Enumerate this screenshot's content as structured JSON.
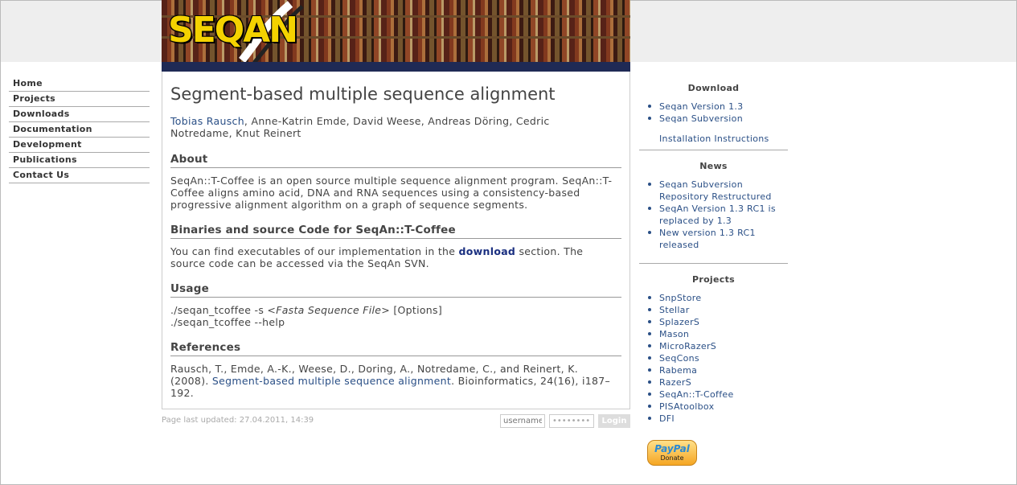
{
  "site": {
    "logo_text": "SEQAN"
  },
  "nav": [
    {
      "label": "Home"
    },
    {
      "label": "Projects"
    },
    {
      "label": "Downloads"
    },
    {
      "label": "Documentation"
    },
    {
      "label": "Development"
    },
    {
      "label": "Publications"
    },
    {
      "label": "Contact Us"
    }
  ],
  "main": {
    "title": "Segment-based multiple sequence alignment",
    "authors_link": "Tobias Rausch",
    "authors_rest": ", Anne-Katrin Emde, David Weese, Andreas Döring, Cedric Notredame, Knut Reinert",
    "about_heading": "About",
    "about_text": "SeqAn::T-Coffee is an open source multiple sequence alignment program. SeqAn::T-Coffee aligns amino acid, DNA and RNA sequences using a consistency-based progressive alignment algorithm on a graph of sequence segments.",
    "binaries_heading": "Binaries and source Code for SeqAn::T-Coffee",
    "binaries_pre": "You can find executables of our implementation in the ",
    "binaries_link": "download",
    "binaries_post": " section. The source code can be accessed via the SeqAn SVN.",
    "usage_heading": "Usage",
    "usage_line1_pre": "./seqan_tcoffee -s <",
    "usage_line1_italic": "Fasta Sequence File",
    "usage_line1_post": "> [Options]",
    "usage_line2": "./seqan_tcoffee --help",
    "references_heading": "References",
    "ref_pre": "Rausch, T., Emde, A.-K., Weese, D., Doring, A., Notredame, C., and Reinert, K. (2008). ",
    "ref_link": "Segment-based multiple sequence alignment",
    "ref_post": ". Bioinformatics, 24(16), i187–192."
  },
  "footer": {
    "last_updated": "Page last updated: 27.04.2011, 14:39",
    "username_placeholder": "username",
    "password_value": "••••••••",
    "login_label": "Login"
  },
  "sidebar": {
    "download_heading": "Download",
    "download_items": [
      "Seqan Version 1.3",
      "Seqan Subversion"
    ],
    "install_link": "Installation Instructions",
    "news_heading": "News",
    "news_items": [
      "Seqan Subversion Repository Restructured",
      "SeqAn Version 1.3 RC1 is replaced by 1.3",
      "New version 1.3 RC1 released"
    ],
    "projects_heading": "Projects",
    "project_items": [
      "SnpStore",
      "Stellar",
      "SplazerS",
      "Mason",
      "MicroRazerS",
      "SeqCons",
      "Rabema",
      "RazerS",
      "SeqAn::T-Coffee",
      "PISAtoolbox",
      "DFI"
    ],
    "paypal_brand_a": "Pay",
    "paypal_brand_b": "Pal",
    "paypal_donate": "Donate"
  },
  "colors": {
    "link": "#2a4f86",
    "strong_link": "#1a2f80",
    "banner_bar": "#1f2a55",
    "logo": "#f4d200"
  }
}
